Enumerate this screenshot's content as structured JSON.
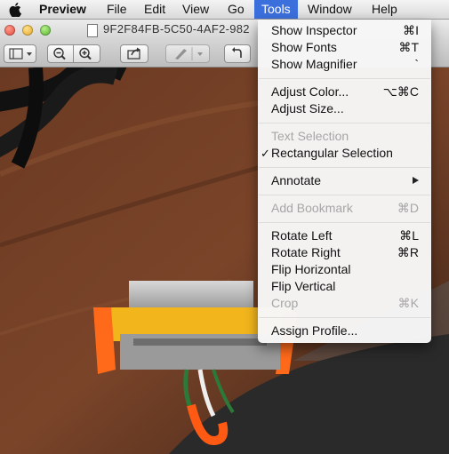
{
  "menubar": {
    "app_name": "Preview",
    "items": [
      "File",
      "Edit",
      "View",
      "Go",
      "Tools",
      "Window",
      "Help"
    ]
  },
  "window": {
    "title": "9F2F84FB-5C50-4AF2-982"
  },
  "tools_menu": {
    "items": [
      {
        "label": "Show Inspector",
        "shortcut": "⌘I"
      },
      {
        "label": "Show Fonts",
        "shortcut": "⌘T"
      },
      {
        "label": "Show Magnifier",
        "shortcut": "`"
      },
      {
        "label": "Adjust Color...",
        "shortcut": "⌥⌘C"
      },
      {
        "label": "Adjust Size...",
        "shortcut": ""
      },
      {
        "label": "Text Selection",
        "shortcut": "",
        "disabled": true
      },
      {
        "label": "Rectangular Selection",
        "shortcut": "",
        "checked": true
      },
      {
        "label": "Annotate",
        "shortcut": "",
        "submenu": true
      },
      {
        "label": "Add Bookmark",
        "shortcut": "⌘D",
        "disabled": true
      },
      {
        "label": "Rotate Left",
        "shortcut": "⌘L"
      },
      {
        "label": "Rotate Right",
        "shortcut": "⌘R"
      },
      {
        "label": "Flip Horizontal",
        "shortcut": ""
      },
      {
        "label": "Flip Vertical",
        "shortcut": ""
      },
      {
        "label": "Crop",
        "shortcut": "⌘K",
        "disabled": true
      },
      {
        "label": "Assign Profile...",
        "shortcut": ""
      }
    ],
    "check_glyph": "✓"
  },
  "colors": {
    "menu_highlight": "#3b6fdc",
    "disabled_text": "#a6a6a6"
  },
  "icons": [
    "apple-icon",
    "document-icon",
    "sidebar-toggle-icon",
    "zoom-out-icon",
    "zoom-in-icon",
    "share-icon",
    "markup-pen-icon",
    "rotate-icon"
  ]
}
